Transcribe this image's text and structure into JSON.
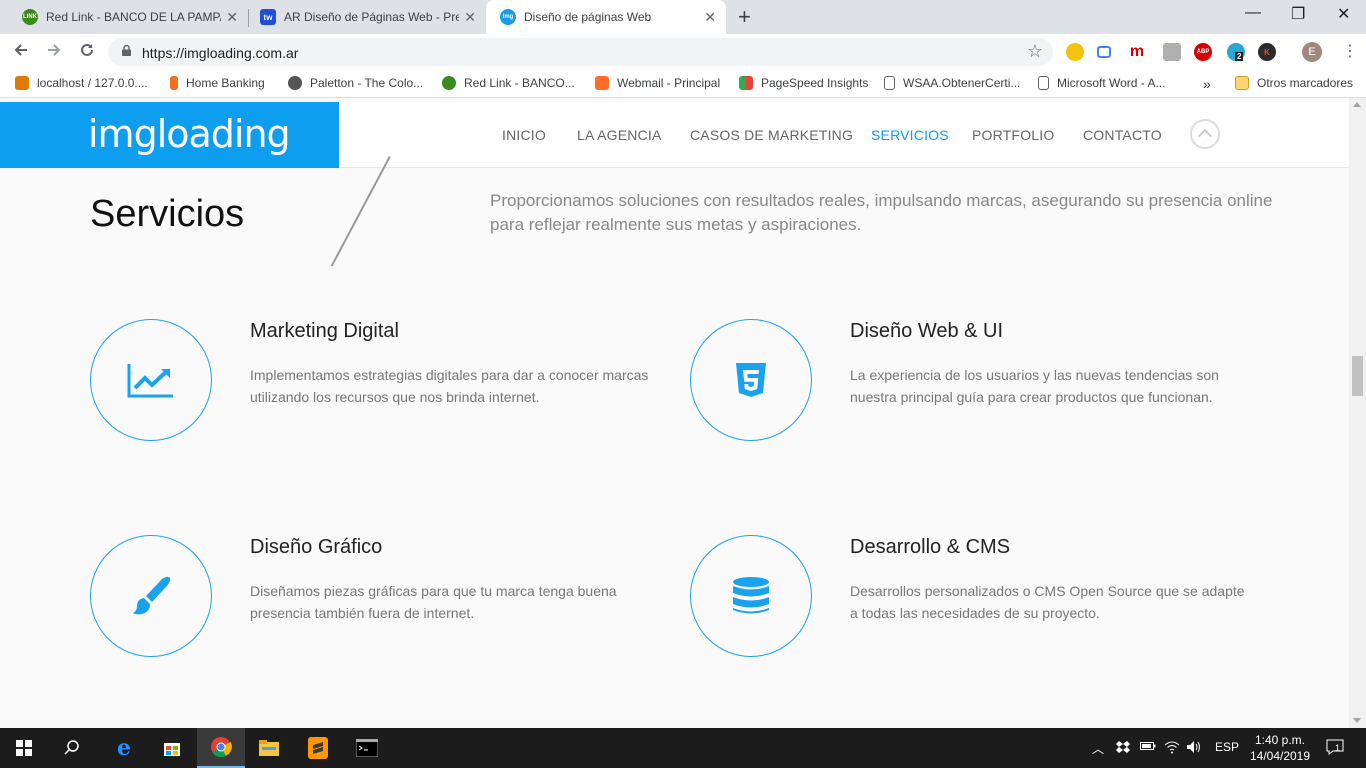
{
  "browser": {
    "tabs": [
      {
        "title": "Red Link - BANCO DE LA PAMPA",
        "favicon": "link-logo-icon",
        "active": false
      },
      {
        "title": "AR Diseño de Páginas Web - Prec",
        "favicon": "tw-icon",
        "active": false
      },
      {
        "title": "Diseño de páginas Web",
        "favicon": "imgloading-icon",
        "active": true
      }
    ],
    "new_tab": "+",
    "window_controls": {
      "minimize": "—",
      "restore": "❐",
      "close": "✕"
    },
    "url": "https://imgloading.com.ar",
    "bookmarks": [
      {
        "label": "localhost / 127.0.0....",
        "icon": "pma-icon",
        "color": "#e07b00"
      },
      {
        "label": "Home Banking",
        "icon": "bookmark-orange-icon",
        "color": "#f37021"
      },
      {
        "label": "Paletton - The Colo...",
        "icon": "paletton-icon",
        "color": "#555555"
      },
      {
        "label": "Red Link - BANCO...",
        "icon": "link-logo-icon",
        "color": "#3a8a1e"
      },
      {
        "label": "Webmail - Principal",
        "icon": "cpanel-icon",
        "color": "#ff6c2c"
      },
      {
        "label": "PageSpeed Insights",
        "icon": "pagespeed-icon",
        "color": "#4285f4"
      },
      {
        "label": "WSAA.ObtenerCerti...",
        "icon": "page-icon",
        "color": "#ffffff"
      },
      {
        "label": "Microsoft Word - A...",
        "icon": "page-icon",
        "color": "#ffffff"
      }
    ],
    "bookmarks_overflow": "»",
    "other_bookmarks": "Otros marcadores",
    "profile_initial": "E",
    "ext_badge": "2",
    "ext_labels": {
      "m": "m",
      "abp": "ABP",
      "k": "K"
    }
  },
  "site": {
    "logo": "imgloading",
    "nav": [
      "INICIO",
      "LA AGENCIA",
      "CASOS DE MARKETING",
      "SERVICIOS",
      "PORTFOLIO",
      "CONTACTO"
    ],
    "active_nav": "SERVICIOS",
    "accent_color": "#0d9ef0",
    "title": "Servicios",
    "intro": "Proporcionamos soluciones con resultados reales, impulsando marcas, asegurando su presencia online para reflejar realmente sus metas y aspiraciones.",
    "services": [
      {
        "title": "Marketing Digital",
        "desc": "Implementamos estrategias digitales para dar a conocer marcas utilizando los recursos que nos brinda internet.",
        "icon": "chart-line-icon"
      },
      {
        "title": "Diseño Web & UI",
        "desc": "La experiencia de los usuarios y las nuevas tendencias son nuestra principal guía para crear productos que funcionan.",
        "icon": "html5-icon"
      },
      {
        "title": "Diseño Gráfico",
        "desc": "Diseñamos piezas gráficas para que tu marca tenga buena presencia también fuera de internet.",
        "icon": "paintbrush-icon"
      },
      {
        "title": "Desarrollo & CMS",
        "desc": "Desarrollos personalizados o CMS Open Source que se adapte a todas las necesidades de su proyecto.",
        "icon": "database-icon"
      }
    ]
  },
  "taskbar": {
    "apps": [
      "windows-start-icon",
      "search-icon",
      "edge-icon",
      "store-icon",
      "chrome-icon",
      "file-explorer-icon",
      "sublime-text-icon",
      "terminal-icon"
    ],
    "active_app": "chrome-icon",
    "language": "ESP",
    "time": "1:40 p.m.",
    "date": "14/04/2019",
    "notifications": "1"
  }
}
